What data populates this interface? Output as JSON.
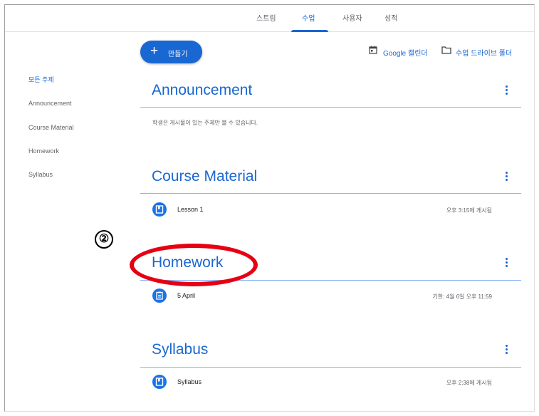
{
  "nav": {
    "tabs": [
      {
        "label": "스트림"
      },
      {
        "label": "수업",
        "active": true
      },
      {
        "label": "사용자"
      },
      {
        "label": "성적"
      }
    ]
  },
  "toolbar": {
    "create_label": "만들기",
    "calendar_label": "Google 캘린더",
    "drive_label": "수업 드라이브 폴더"
  },
  "sidebar": {
    "items": [
      {
        "label": "모든 주제",
        "active": true
      },
      {
        "label": "Announcement"
      },
      {
        "label": "Course Material"
      },
      {
        "label": "Homework"
      },
      {
        "label": "Syllabus"
      }
    ]
  },
  "sections": [
    {
      "title": "Announcement",
      "note": "학생은 게시물이 있는 주제만 볼 수 있습니다.",
      "items": []
    },
    {
      "title": "Course Material",
      "items": [
        {
          "title": "Lesson 1",
          "meta": "오후 3:15에 게시됨",
          "icon": "material-icon"
        }
      ]
    },
    {
      "title": "Homework",
      "items": [
        {
          "title": "5 April",
          "meta": "기한: 4월 6일 오후 11:59",
          "icon": "assignment-icon"
        }
      ]
    },
    {
      "title": "Syllabus",
      "items": [
        {
          "title": "Syllabus",
          "meta": "오후 2:38에 게시됨",
          "icon": "material-icon"
        }
      ]
    }
  ],
  "annotation": {
    "number": "②",
    "highlight_color": "#e60012"
  },
  "colors": {
    "accent": "#1967d2",
    "icon_bg": "#1a73e8"
  }
}
